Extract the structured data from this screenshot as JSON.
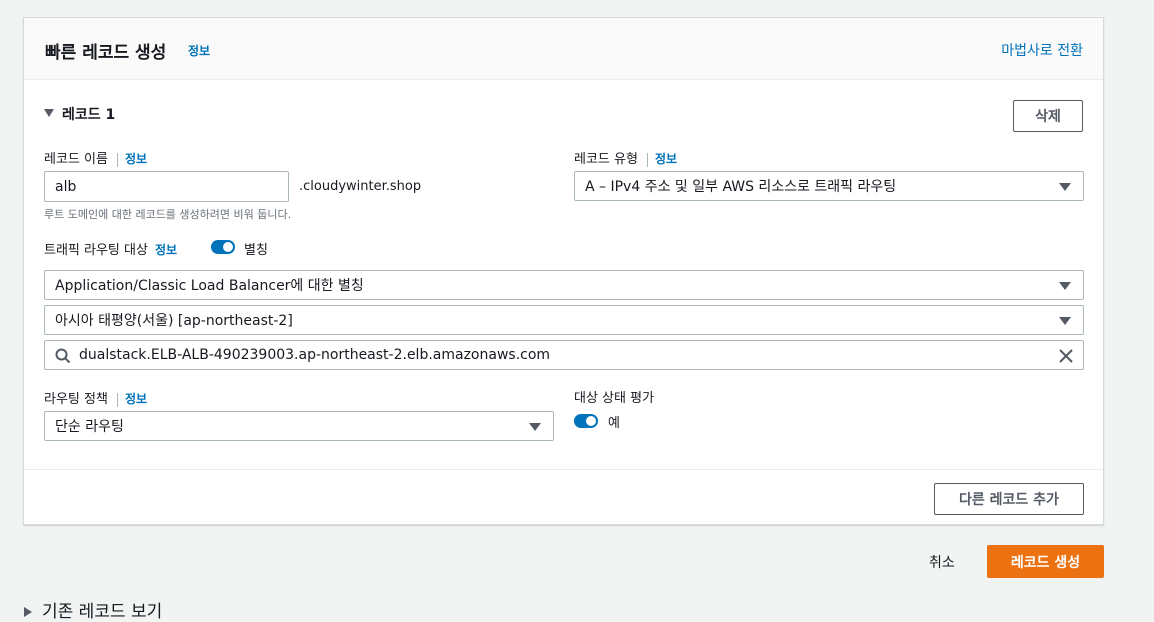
{
  "panel": {
    "title": "빠른 레코드 생성",
    "title_info": "정보",
    "wizard_link": "마법사로 전환"
  },
  "record": {
    "header": "레코드 1",
    "delete_label": "삭제",
    "name_label": "레코드 이름",
    "name_info": "정보",
    "name_value": "alb",
    "domain_suffix": ".cloudywinter.shop",
    "name_hint": "루트 도메인에 대한 레코드를 생성하려면 비워 둡니다.",
    "type_label": "레코드 유형",
    "type_info": "정보",
    "type_value": "A – IPv4 주소 및 일부 AWS 리소스로 트래픽 라우팅",
    "target_label": "트래픽 라우팅 대상",
    "target_info": "정보",
    "alias_label": "별칭",
    "alias_enabled": true,
    "endpoint_value": "Application/Classic Load Balancer에 대한 별칭",
    "region_value": "아시아 태평양(서울) [ap-northeast-2]",
    "lb_value": "dualstack.ELB-ALB-490239003.ap-northeast-2.elb.amazonaws.com",
    "policy_label": "라우팅 정책",
    "policy_info": "정보",
    "policy_value": "단순 라우팅",
    "health_label": "대상 상태 평가",
    "health_value": "예",
    "health_enabled": true
  },
  "footer": {
    "add_record_label": "다른 레코드 추가"
  },
  "actions": {
    "cancel_label": "취소",
    "create_label": "레코드 생성"
  },
  "existing_records_label": "기존 레코드 보기",
  "colors": {
    "link": "#0073bb",
    "primary": "#ec7211",
    "toggle": "#0073bb"
  }
}
